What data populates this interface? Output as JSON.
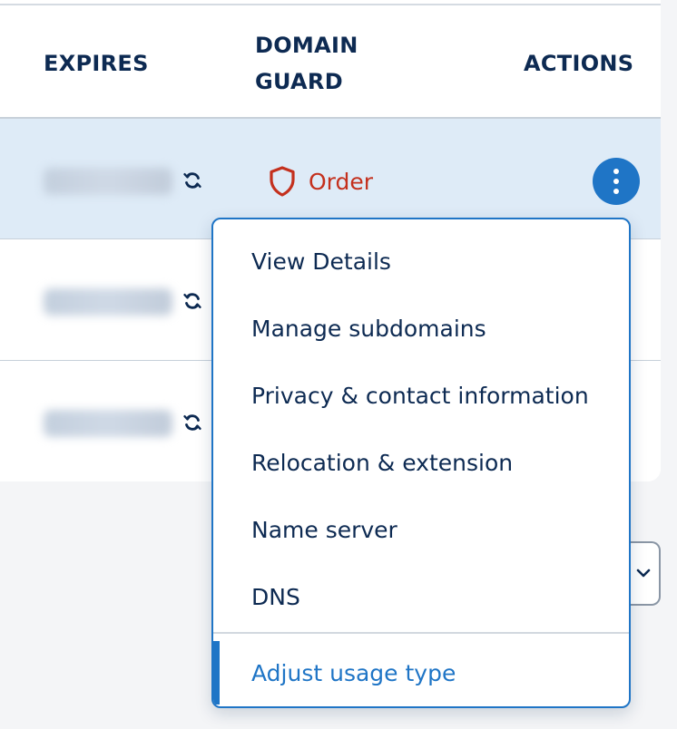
{
  "table": {
    "headers": {
      "expires": "EXPIRES",
      "domain_guard_line1": "DOMAIN",
      "domain_guard_line2": "GUARD",
      "actions": "ACTIONS"
    },
    "rows": [
      {
        "highlighted": true,
        "guard_label": "Order"
      },
      {
        "highlighted": false
      },
      {
        "highlighted": false
      }
    ]
  },
  "icons": {
    "renew": "renew-icon",
    "shield": "shield-icon",
    "kebab": "kebab-menu-icon",
    "chevron": "chevron-down-icon"
  },
  "context_menu": {
    "items": [
      "View Details",
      "Manage subdomains",
      "Privacy & contact information",
      "Relocation & extension",
      "Name server",
      "DNS",
      "Adjust usage type"
    ],
    "active_index": 6
  },
  "colors": {
    "primary": "#1f75c6",
    "heading": "#0d2a52",
    "order_red": "#c4301d",
    "row_highlight": "#deebf7"
  }
}
